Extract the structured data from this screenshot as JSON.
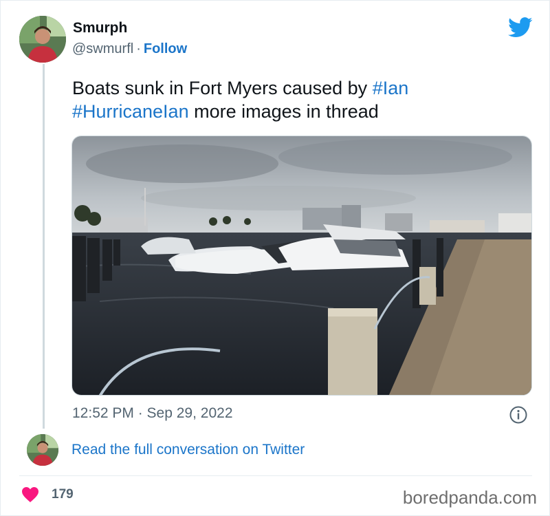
{
  "author": {
    "name": "Smurph",
    "handle": "@swmurfl",
    "separator": "·",
    "follow_label": "Follow"
  },
  "tweet": {
    "text_part1": "Boats sunk in Fort Myers caused by",
    "hashtag1": "#Ian",
    "hashtag2": "#HurricaneIan",
    "text_part2": "more images in thread"
  },
  "media": {
    "description": ""
  },
  "meta": {
    "timestamp": "12:52 PM · Sep 29, 2022"
  },
  "read_more": {
    "label": "Read the full conversation on Twitter"
  },
  "footer": {
    "likes": "179",
    "watermark": "boredpanda.com"
  },
  "colors": {
    "link": "#1b75c9",
    "twitter_bird": "#1d9bf0",
    "heart": "#f91880"
  },
  "icons": {
    "brand": "twitter-bird-icon",
    "info": "info-icon",
    "like": "heart-icon"
  }
}
